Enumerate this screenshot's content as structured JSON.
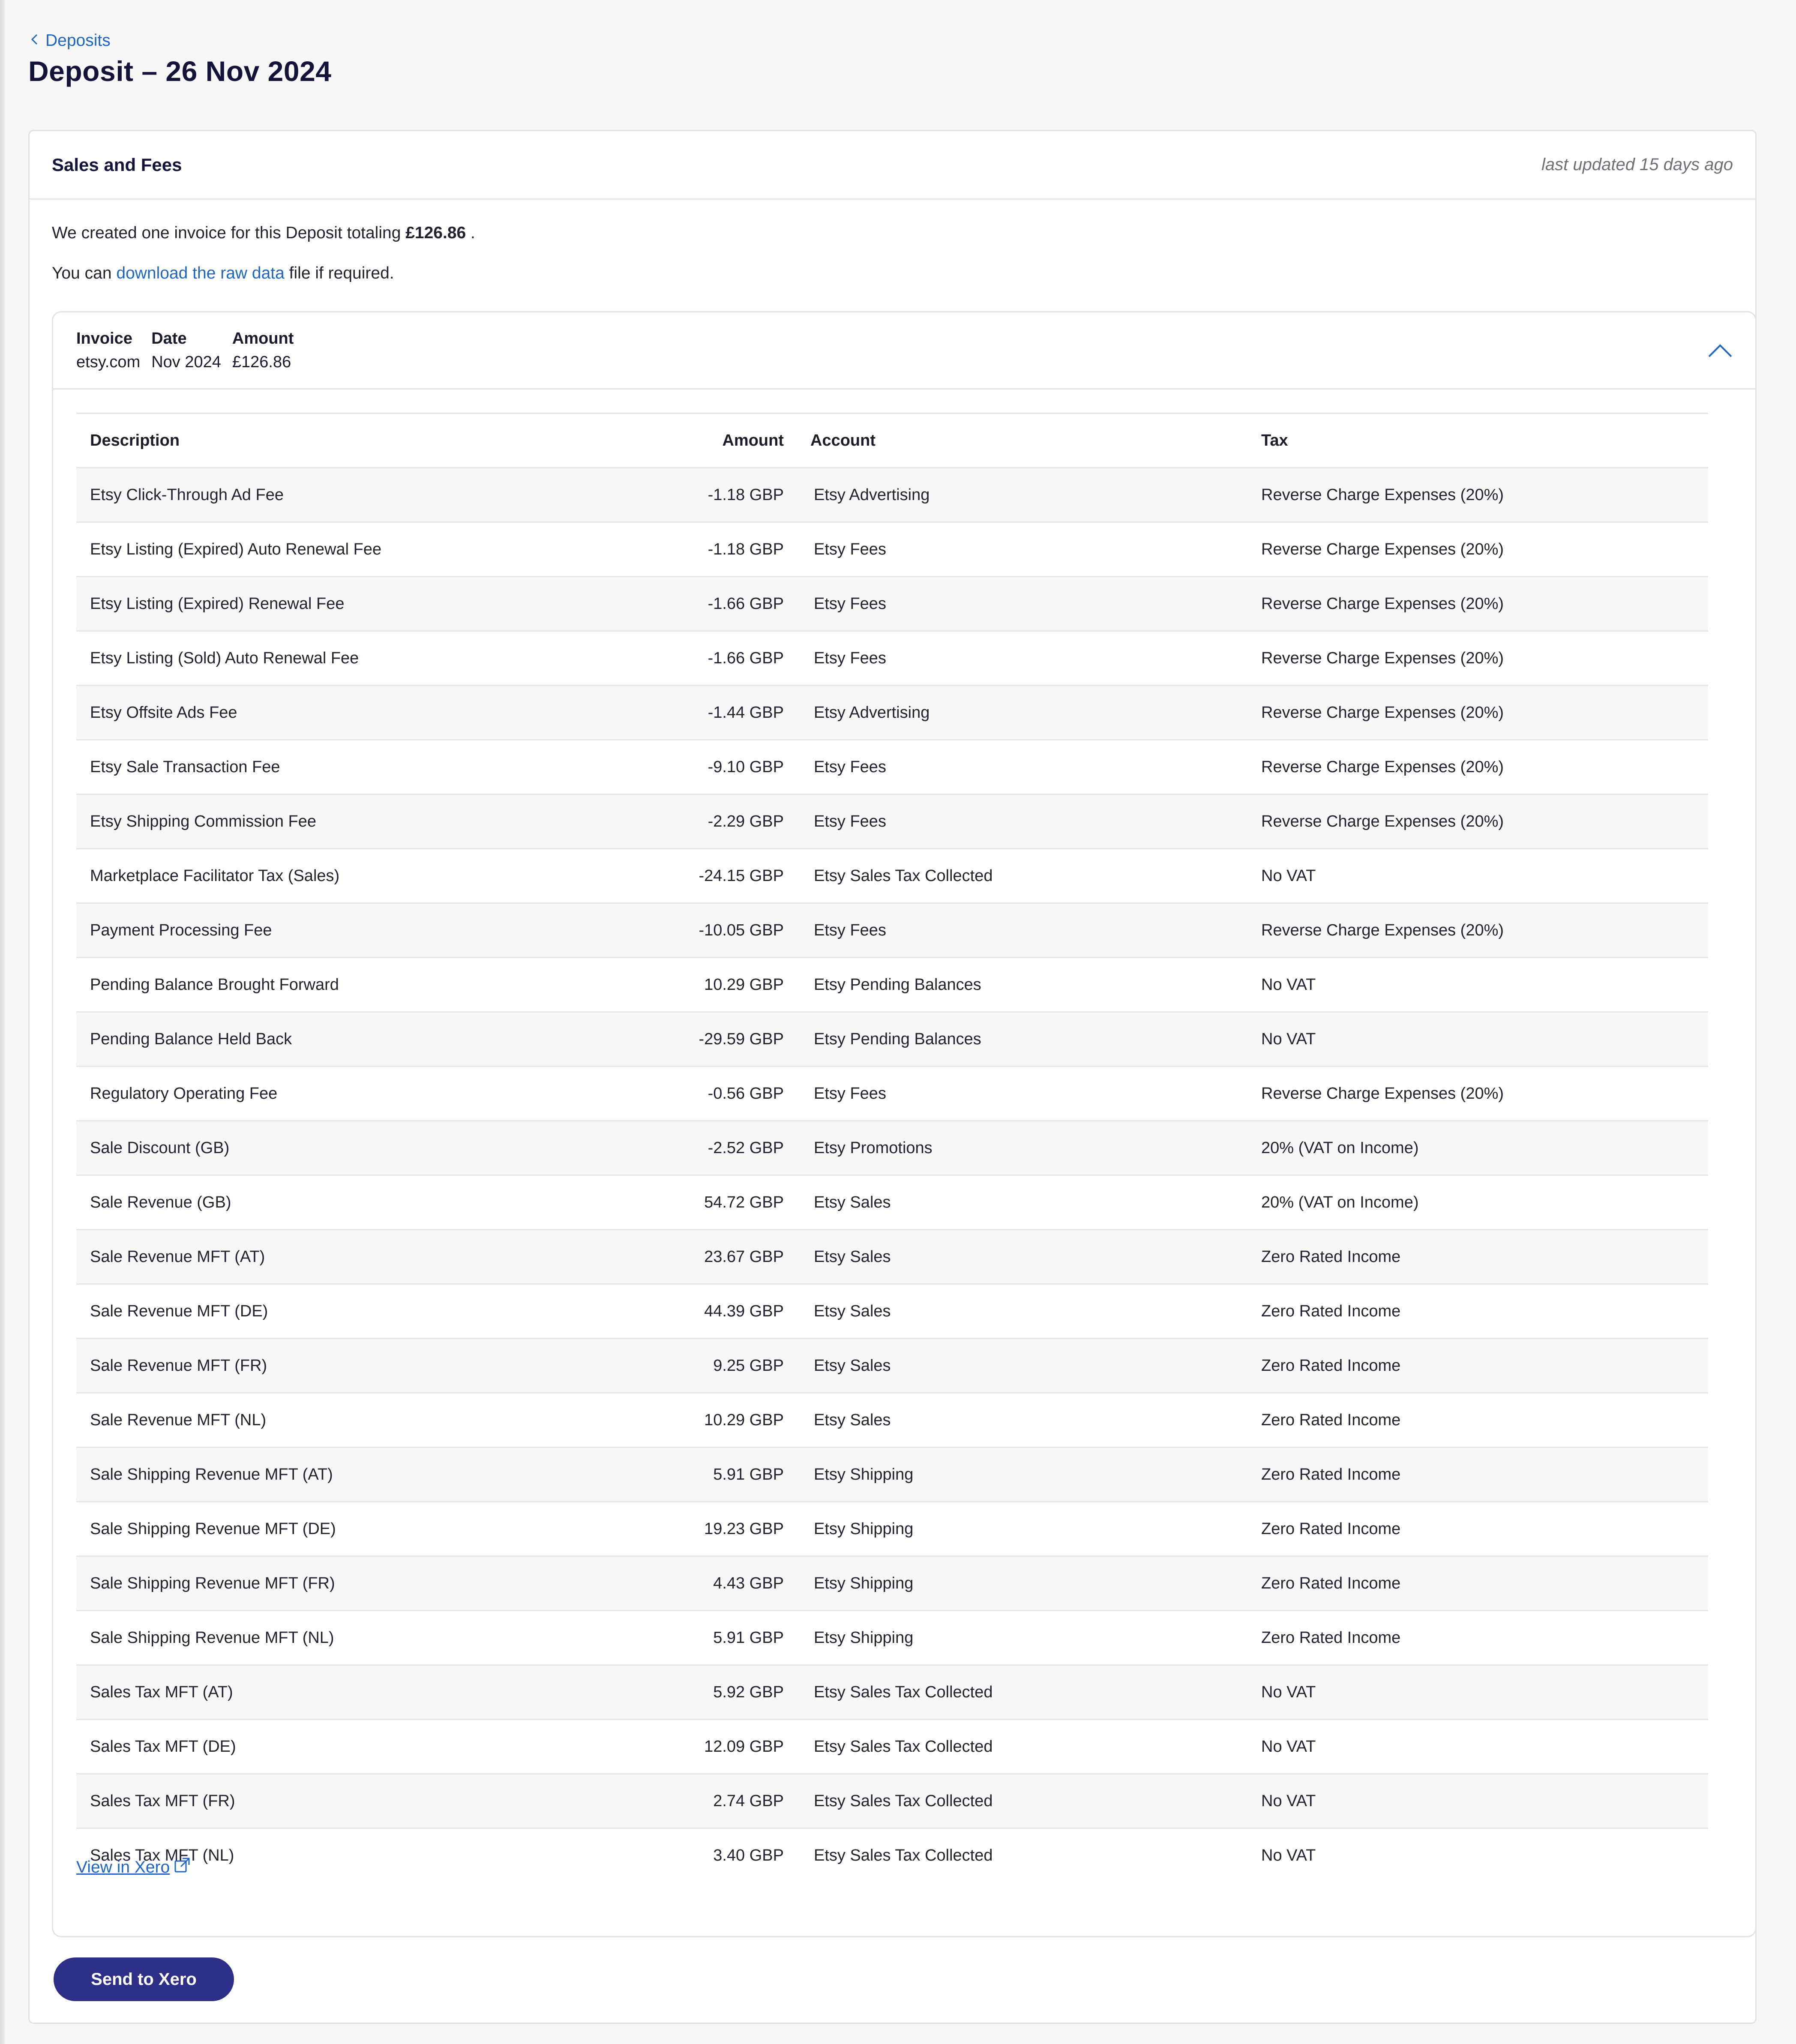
{
  "breadcrumb": {
    "label": "Deposits"
  },
  "page": {
    "title": "Deposit – 26 Nov 2024"
  },
  "card": {
    "title": "Sales and Fees",
    "last_updated": "last updated 15 days ago"
  },
  "intro": {
    "line1_prefix": "We created one invoice for this Deposit totaling ",
    "line1_total": "£126.86",
    "line1_suffix": " .",
    "line2_prefix": "You can ",
    "line2_link": "download the raw data",
    "line2_suffix": " file if required."
  },
  "invoice": {
    "headers": {
      "invoice": "Invoice",
      "date": "Date",
      "amount": "Amount"
    },
    "values": {
      "invoice": "etsy.com",
      "date": "Nov 2024",
      "amount": "£126.86"
    }
  },
  "table": {
    "columns": {
      "description": "Description",
      "amount": "Amount",
      "account": "Account",
      "tax": "Tax"
    },
    "rows": [
      {
        "description": "Etsy Click-Through Ad Fee",
        "amount": "-1.18 GBP",
        "account": "Etsy Advertising",
        "tax": "Reverse Charge Expenses (20%)"
      },
      {
        "description": "Etsy Listing (Expired) Auto Renewal Fee",
        "amount": "-1.18 GBP",
        "account": "Etsy Fees",
        "tax": "Reverse Charge Expenses (20%)"
      },
      {
        "description": "Etsy Listing (Expired) Renewal Fee",
        "amount": "-1.66 GBP",
        "account": "Etsy Fees",
        "tax": "Reverse Charge Expenses (20%)"
      },
      {
        "description": "Etsy Listing (Sold) Auto Renewal Fee",
        "amount": "-1.66 GBP",
        "account": "Etsy Fees",
        "tax": "Reverse Charge Expenses (20%)"
      },
      {
        "description": "Etsy Offsite Ads Fee",
        "amount": "-1.44 GBP",
        "account": "Etsy Advertising",
        "tax": "Reverse Charge Expenses (20%)"
      },
      {
        "description": "Etsy Sale Transaction Fee",
        "amount": "-9.10 GBP",
        "account": "Etsy Fees",
        "tax": "Reverse Charge Expenses (20%)"
      },
      {
        "description": "Etsy Shipping Commission Fee",
        "amount": "-2.29 GBP",
        "account": "Etsy Fees",
        "tax": "Reverse Charge Expenses (20%)"
      },
      {
        "description": "Marketplace Facilitator Tax (Sales)",
        "amount": "-24.15 GBP",
        "account": "Etsy Sales Tax Collected",
        "tax": "No VAT"
      },
      {
        "description": "Payment Processing Fee",
        "amount": "-10.05 GBP",
        "account": "Etsy Fees",
        "tax": "Reverse Charge Expenses (20%)"
      },
      {
        "description": "Pending Balance Brought Forward",
        "amount": "10.29 GBP",
        "account": "Etsy Pending Balances",
        "tax": "No VAT"
      },
      {
        "description": "Pending Balance Held Back",
        "amount": "-29.59 GBP",
        "account": "Etsy Pending Balances",
        "tax": "No VAT"
      },
      {
        "description": "Regulatory Operating Fee",
        "amount": "-0.56 GBP",
        "account": "Etsy Fees",
        "tax": "Reverse Charge Expenses (20%)"
      },
      {
        "description": "Sale Discount (GB)",
        "amount": "-2.52 GBP",
        "account": "Etsy Promotions",
        "tax": "20% (VAT on Income)"
      },
      {
        "description": "Sale Revenue (GB)",
        "amount": "54.72 GBP",
        "account": "Etsy Sales",
        "tax": "20% (VAT on Income)"
      },
      {
        "description": "Sale Revenue MFT (AT)",
        "amount": "23.67 GBP",
        "account": "Etsy Sales",
        "tax": "Zero Rated Income"
      },
      {
        "description": "Sale Revenue MFT (DE)",
        "amount": "44.39 GBP",
        "account": "Etsy Sales",
        "tax": "Zero Rated Income"
      },
      {
        "description": "Sale Revenue MFT (FR)",
        "amount": "9.25 GBP",
        "account": "Etsy Sales",
        "tax": "Zero Rated Income"
      },
      {
        "description": "Sale Revenue MFT (NL)",
        "amount": "10.29 GBP",
        "account": "Etsy Sales",
        "tax": "Zero Rated Income"
      },
      {
        "description": "Sale Shipping Revenue MFT (AT)",
        "amount": "5.91 GBP",
        "account": "Etsy Shipping",
        "tax": "Zero Rated Income"
      },
      {
        "description": "Sale Shipping Revenue MFT (DE)",
        "amount": "19.23 GBP",
        "account": "Etsy Shipping",
        "tax": "Zero Rated Income"
      },
      {
        "description": "Sale Shipping Revenue MFT (FR)",
        "amount": "4.43 GBP",
        "account": "Etsy Shipping",
        "tax": "Zero Rated Income"
      },
      {
        "description": "Sale Shipping Revenue MFT (NL)",
        "amount": "5.91 GBP",
        "account": "Etsy Shipping",
        "tax": "Zero Rated Income"
      },
      {
        "description": "Sales Tax MFT (AT)",
        "amount": "5.92 GBP",
        "account": "Etsy Sales Tax Collected",
        "tax": "No VAT"
      },
      {
        "description": "Sales Tax MFT (DE)",
        "amount": "12.09 GBP",
        "account": "Etsy Sales Tax Collected",
        "tax": "No VAT"
      },
      {
        "description": "Sales Tax MFT (FR)",
        "amount": "2.74 GBP",
        "account": "Etsy Sales Tax Collected",
        "tax": "No VAT"
      },
      {
        "description": "Sales Tax MFT (NL)",
        "amount": "3.40 GBP",
        "account": "Etsy Sales Tax Collected",
        "tax": "No VAT"
      }
    ]
  },
  "links": {
    "view_in_xero": "View in Xero"
  },
  "actions": {
    "send_to_xero": "Send to Xero"
  },
  "icons": {
    "back": "chevron-left-icon",
    "collapse": "chevron-up-icon",
    "external": "external-link-icon"
  },
  "colors": {
    "link": "#1f66c4",
    "primary_button": "#2e2f86",
    "title": "#14143a"
  }
}
